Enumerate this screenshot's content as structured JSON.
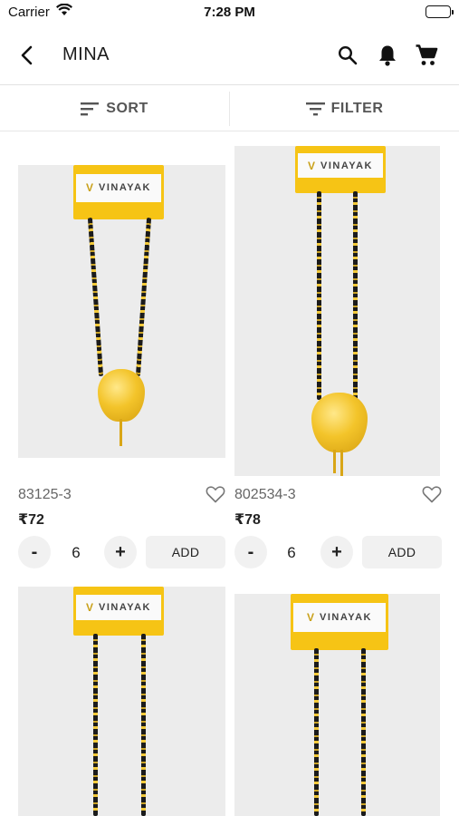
{
  "status_bar": {
    "carrier": "Carrier",
    "time": "7:28 PM"
  },
  "nav": {
    "title": "MINA"
  },
  "toolbar": {
    "sort_label": "SORT",
    "filter_label": "FILTER"
  },
  "products": [
    {
      "code": "83125-3",
      "price": "₹72",
      "qty": "6",
      "add_label": "ADD",
      "minus": "-",
      "plus": "+",
      "brand": "VINAYAK"
    },
    {
      "code": "802534-3",
      "price": "₹78",
      "qty": "6",
      "add_label": "ADD",
      "minus": "-",
      "plus": "+",
      "brand": "VINAYAK"
    },
    {
      "brand": "VINAYAK"
    },
    {
      "brand": "VINAYAK"
    }
  ]
}
